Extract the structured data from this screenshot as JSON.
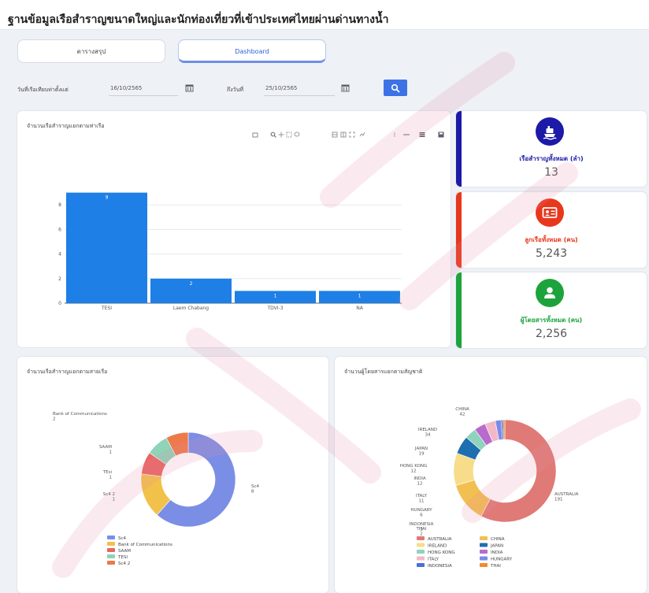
{
  "header": {
    "title": "ฐานข้อมูลเรือสำราญขนาดใหญ่และนักท่องเที่ยวที่เข้าประเทศไทยผ่านด่านทางน้ำ"
  },
  "tabs": [
    {
      "label": "ตารางสรุป",
      "active": false
    },
    {
      "label": "Dashboard",
      "active": true
    }
  ],
  "filter": {
    "from_label": "วันที่เรือเทียบท่าตั้งแต่",
    "from_value": "16/10/2565",
    "to_label": "ถึงวันที่",
    "to_value": "25/10/2565"
  },
  "bar_card": {
    "title": "จำนวนเรือสำราญแยกตามท่าเรือ"
  },
  "stats": [
    {
      "label": "เรือสำราญทั้งหมด (ลำ)",
      "value": "13",
      "color": "#1d1aa8",
      "icon": "ship-icon"
    },
    {
      "label": "ลูกเรือทั้งหมด (คน)",
      "value": "5,243",
      "color": "#e8371c",
      "icon": "id-card-icon"
    },
    {
      "label": "ผู้โดยสารทั้งหมด (คน)",
      "value": "2,256",
      "color": "#1da33b",
      "icon": "person-icon"
    }
  ],
  "port_donut_card": {
    "title": "จำนวนเรือสำราญแยกตามสายเรือ"
  },
  "nation_donut_card": {
    "title": "จำนวนผู้โดยสารแยกตามสัญชาติ"
  },
  "chart_data": [
    {
      "type": "bar",
      "categories": [
        "TESI",
        "Laem Chabang",
        "TDVI-3",
        "NA"
      ],
      "values": [
        9,
        2,
        1,
        1
      ],
      "ylim": [
        0,
        10
      ],
      "yticks": [
        0,
        2,
        4,
        6,
        8
      ],
      "color": "#1e7fe6"
    },
    {
      "type": "pie",
      "donut": true,
      "categories": [
        "Sc4",
        "Bank of Communications",
        "SAAM",
        "TESI",
        "Sc4 2"
      ],
      "values": [
        8,
        2,
        1,
        1,
        1
      ],
      "slice_labels": [
        "Sc4\n8",
        "Bank of Communications\n2",
        "SAAM\n1",
        "TEsi\n1",
        "Sc4 2\n1"
      ],
      "colors": [
        "#7b8ee5",
        "#f2c14a",
        "#ea6464",
        "#8ed4b7",
        "#ec7a4b"
      ],
      "legend": [
        "Sc4",
        "Bank of Communications",
        "SAAM",
        "TESI",
        "Sc4 2"
      ]
    },
    {
      "type": "pie",
      "donut": true,
      "categories": [
        "AUSTRALIA",
        "CHINA",
        "IRELAND",
        "JAPAN",
        "HONG KONG",
        "INDIA",
        "ITALY",
        "HUNGARY",
        "INDONESIA",
        "THAI"
      ],
      "values": [
        191,
        42,
        34,
        19,
        12,
        12,
        11,
        6,
        2,
        2
      ],
      "slice_labels": [
        "AUSTRALIA\n191",
        "CHINA\n42",
        "IRELAND\n34",
        "JAPAN\n19",
        "HONG KONG\n12",
        "INDIA\n12",
        "ITALY\n11",
        "HUNGARY\n6",
        "INDONESIA\n2",
        "THAI\n2"
      ],
      "colors": [
        "#e07a76",
        "#f2bf51",
        "#f7dd8a",
        "#1e6fb0",
        "#8fd3bd",
        "#b86acd",
        "#f3b8c7",
        "#7a8ae6",
        "#4d70d6",
        "#f28a2c"
      ],
      "legend": [
        "AUSTRALIA",
        "CHINA",
        "IRELAND",
        "JAPAN",
        "HONG KONG",
        "INDIA",
        "ITALY",
        "HUNGARY",
        "INDONESIA",
        "THAI"
      ]
    }
  ]
}
